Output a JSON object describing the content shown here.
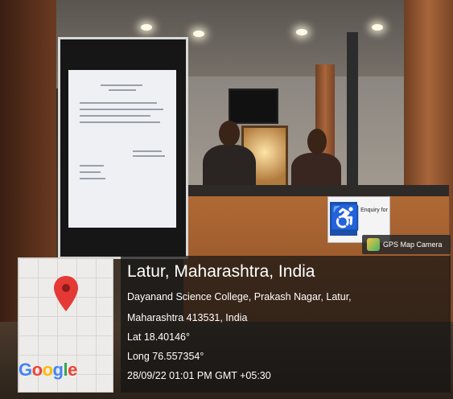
{
  "overlay": {
    "app_badge": "GPS Map Camera",
    "place_title": "Latur, Maharashtra, India",
    "address_line1": "Dayanand Science College, Prakash Nagar, Latur,",
    "address_line2": "Maharashtra 413531, India",
    "latitude": "Lat 18.40146°",
    "longitude": "Long 76.557354°",
    "timestamp": "28/09/22 01:01 PM GMT +05:30",
    "map_brand": [
      "G",
      "o",
      "o",
      "g",
      "l",
      "e"
    ],
    "map_brand_colors": [
      "#4285F4",
      "#EA4335",
      "#FBBC05",
      "#4285F4",
      "#34A853",
      "#EA4335"
    ]
  },
  "scene": {
    "accessibility_icon": "wheelchair-icon",
    "sign_text": "Enquiry for"
  }
}
